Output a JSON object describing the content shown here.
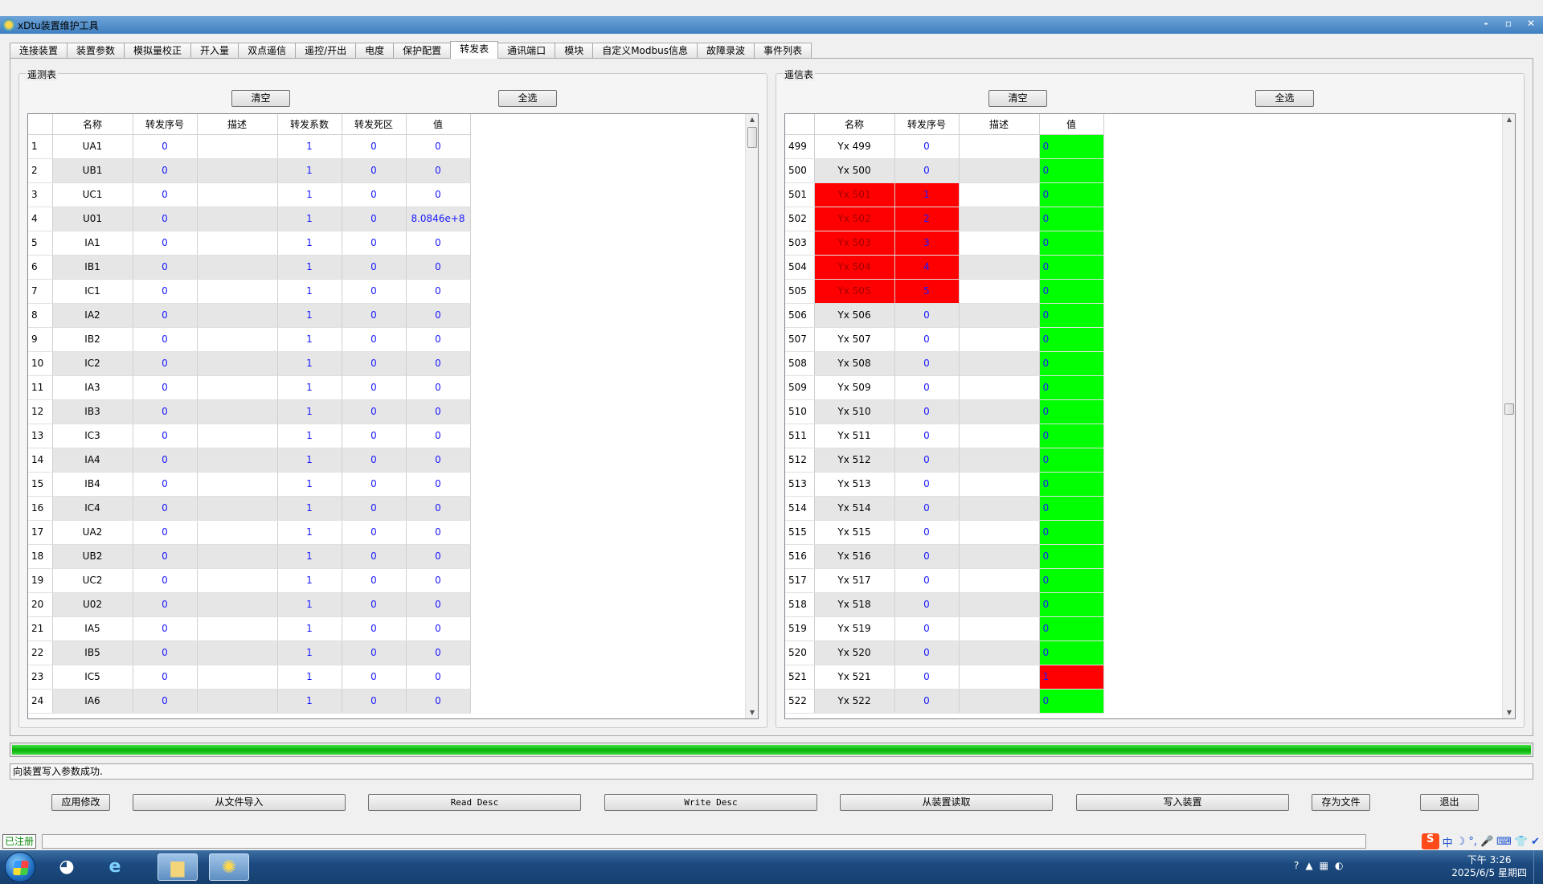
{
  "window": {
    "title": "xDtu装置维护工具",
    "controls": [
      "-",
      "▫",
      "✕"
    ]
  },
  "tabs": [
    "连接装置",
    "装置参数",
    "模拟量校正",
    "开入量",
    "双点遥信",
    "遥控/开出",
    "电度",
    "保护配置",
    "转发表",
    "通讯端口",
    "模块",
    "自定义Modbus信息",
    "故障录波",
    "事件列表"
  ],
  "active_tab_index": 8,
  "left_group": {
    "title": "遥测表",
    "clear_label": "清空",
    "select_all_label": "全选",
    "columns": [
      "名称",
      "转发序号",
      "描述",
      "转发系数",
      "转发死区",
      "值"
    ],
    "rows": [
      {
        "idx": "1",
        "name": "UA1",
        "seq": "0",
        "desc": "",
        "coef": "1",
        "dead": "0",
        "value": "0"
      },
      {
        "idx": "2",
        "name": "UB1",
        "seq": "0",
        "desc": "",
        "coef": "1",
        "dead": "0",
        "value": "0"
      },
      {
        "idx": "3",
        "name": "UC1",
        "seq": "0",
        "desc": "",
        "coef": "1",
        "dead": "0",
        "value": "0"
      },
      {
        "idx": "4",
        "name": "U01",
        "seq": "0",
        "desc": "",
        "coef": "1",
        "dead": "0",
        "value": "8.0846e+8"
      },
      {
        "idx": "5",
        "name": "IA1",
        "seq": "0",
        "desc": "",
        "coef": "1",
        "dead": "0",
        "value": "0"
      },
      {
        "idx": "6",
        "name": "IB1",
        "seq": "0",
        "desc": "",
        "coef": "1",
        "dead": "0",
        "value": "0"
      },
      {
        "idx": "7",
        "name": "IC1",
        "seq": "0",
        "desc": "",
        "coef": "1",
        "dead": "0",
        "value": "0"
      },
      {
        "idx": "8",
        "name": "IA2",
        "seq": "0",
        "desc": "",
        "coef": "1",
        "dead": "0",
        "value": "0"
      },
      {
        "idx": "9",
        "name": "IB2",
        "seq": "0",
        "desc": "",
        "coef": "1",
        "dead": "0",
        "value": "0"
      },
      {
        "idx": "10",
        "name": "IC2",
        "seq": "0",
        "desc": "",
        "coef": "1",
        "dead": "0",
        "value": "0"
      },
      {
        "idx": "11",
        "name": "IA3",
        "seq": "0",
        "desc": "",
        "coef": "1",
        "dead": "0",
        "value": "0"
      },
      {
        "idx": "12",
        "name": "IB3",
        "seq": "0",
        "desc": "",
        "coef": "1",
        "dead": "0",
        "value": "0"
      },
      {
        "idx": "13",
        "name": "IC3",
        "seq": "0",
        "desc": "",
        "coef": "1",
        "dead": "0",
        "value": "0"
      },
      {
        "idx": "14",
        "name": "IA4",
        "seq": "0",
        "desc": "",
        "coef": "1",
        "dead": "0",
        "value": "0"
      },
      {
        "idx": "15",
        "name": "IB4",
        "seq": "0",
        "desc": "",
        "coef": "1",
        "dead": "0",
        "value": "0"
      },
      {
        "idx": "16",
        "name": "IC4",
        "seq": "0",
        "desc": "",
        "coef": "1",
        "dead": "0",
        "value": "0"
      },
      {
        "idx": "17",
        "name": "UA2",
        "seq": "0",
        "desc": "",
        "coef": "1",
        "dead": "0",
        "value": "0"
      },
      {
        "idx": "18",
        "name": "UB2",
        "seq": "0",
        "desc": "",
        "coef": "1",
        "dead": "0",
        "value": "0"
      },
      {
        "idx": "19",
        "name": "UC2",
        "seq": "0",
        "desc": "",
        "coef": "1",
        "dead": "0",
        "value": "0"
      },
      {
        "idx": "20",
        "name": "U02",
        "seq": "0",
        "desc": "",
        "coef": "1",
        "dead": "0",
        "value": "0"
      },
      {
        "idx": "21",
        "name": "IA5",
        "seq": "0",
        "desc": "",
        "coef": "1",
        "dead": "0",
        "value": "0"
      },
      {
        "idx": "22",
        "name": "IB5",
        "seq": "0",
        "desc": "",
        "coef": "1",
        "dead": "0",
        "value": "0"
      },
      {
        "idx": "23",
        "name": "IC5",
        "seq": "0",
        "desc": "",
        "coef": "1",
        "dead": "0",
        "value": "0"
      },
      {
        "idx": "24",
        "name": "IA6",
        "seq": "0",
        "desc": "",
        "coef": "1",
        "dead": "0",
        "value": "0"
      }
    ]
  },
  "right_group": {
    "title": "遥信表",
    "clear_label": "清空",
    "select_all_label": "全选",
    "columns": [
      "名称",
      "转发序号",
      "描述",
      "值"
    ],
    "rows": [
      {
        "idx": "499",
        "name": "Yx 499",
        "seq": "0",
        "desc": "",
        "value": "0",
        "highlight": false,
        "value_on": false
      },
      {
        "idx": "500",
        "name": "Yx 500",
        "seq": "0",
        "desc": "",
        "value": "0",
        "highlight": false,
        "value_on": false
      },
      {
        "idx": "501",
        "name": "Yx 501",
        "seq": "1",
        "desc": "",
        "value": "0",
        "highlight": true,
        "value_on": false
      },
      {
        "idx": "502",
        "name": "Yx 502",
        "seq": "2",
        "desc": "",
        "value": "0",
        "highlight": true,
        "value_on": false
      },
      {
        "idx": "503",
        "name": "Yx 503",
        "seq": "3",
        "desc": "",
        "value": "0",
        "highlight": true,
        "value_on": false
      },
      {
        "idx": "504",
        "name": "Yx 504",
        "seq": "4",
        "desc": "",
        "value": "0",
        "highlight": true,
        "value_on": false
      },
      {
        "idx": "505",
        "name": "Yx 505",
        "seq": "5",
        "desc": "",
        "value": "0",
        "highlight": true,
        "value_on": false
      },
      {
        "idx": "506",
        "name": "Yx 506",
        "seq": "0",
        "desc": "",
        "value": "0",
        "highlight": false,
        "value_on": false
      },
      {
        "idx": "507",
        "name": "Yx 507",
        "seq": "0",
        "desc": "",
        "value": "0",
        "highlight": false,
        "value_on": false
      },
      {
        "idx": "508",
        "name": "Yx 508",
        "seq": "0",
        "desc": "",
        "value": "0",
        "highlight": false,
        "value_on": false
      },
      {
        "idx": "509",
        "name": "Yx 509",
        "seq": "0",
        "desc": "",
        "value": "0",
        "highlight": false,
        "value_on": false
      },
      {
        "idx": "510",
        "name": "Yx 510",
        "seq": "0",
        "desc": "",
        "value": "0",
        "highlight": false,
        "value_on": false
      },
      {
        "idx": "511",
        "name": "Yx 511",
        "seq": "0",
        "desc": "",
        "value": "0",
        "highlight": false,
        "value_on": false
      },
      {
        "idx": "512",
        "name": "Yx 512",
        "seq": "0",
        "desc": "",
        "value": "0",
        "highlight": false,
        "value_on": false
      },
      {
        "idx": "513",
        "name": "Yx 513",
        "seq": "0",
        "desc": "",
        "value": "0",
        "highlight": false,
        "value_on": false
      },
      {
        "idx": "514",
        "name": "Yx 514",
        "seq": "0",
        "desc": "",
        "value": "0",
        "highlight": false,
        "value_on": false
      },
      {
        "idx": "515",
        "name": "Yx 515",
        "seq": "0",
        "desc": "",
        "value": "0",
        "highlight": false,
        "value_on": false
      },
      {
        "idx": "516",
        "name": "Yx 516",
        "seq": "0",
        "desc": "",
        "value": "0",
        "highlight": false,
        "value_on": false
      },
      {
        "idx": "517",
        "name": "Yx 517",
        "seq": "0",
        "desc": "",
        "value": "0",
        "highlight": false,
        "value_on": false
      },
      {
        "idx": "518",
        "name": "Yx 518",
        "seq": "0",
        "desc": "",
        "value": "0",
        "highlight": false,
        "value_on": false
      },
      {
        "idx": "519",
        "name": "Yx 519",
        "seq": "0",
        "desc": "",
        "value": "0",
        "highlight": false,
        "value_on": false
      },
      {
        "idx": "520",
        "name": "Yx 520",
        "seq": "0",
        "desc": "",
        "value": "0",
        "highlight": false,
        "value_on": false
      },
      {
        "idx": "521",
        "name": "Yx 521",
        "seq": "0",
        "desc": "",
        "value": "1",
        "highlight": false,
        "value_on": true
      },
      {
        "idx": "522",
        "name": "Yx 522",
        "seq": "0",
        "desc": "",
        "value": "0",
        "highlight": false,
        "value_on": false
      }
    ]
  },
  "progress": 1.0,
  "status_message": "向装置写入参数成功.",
  "bottom_buttons": [
    "应用修改",
    "从文件导入",
    "Read Desc",
    "Write Desc",
    "从装置读取",
    "写入装置",
    "存为文件",
    "退出"
  ],
  "statusbar": {
    "registered_label": "已注册"
  },
  "ime_icons": [
    "S",
    "中",
    "☽",
    "°,",
    "🎤",
    "⌨",
    "👕",
    "✔"
  ],
  "taskbar": {
    "apps": [
      "windows-media-icon",
      "ie-icon",
      "explorer-icon",
      "xdtu-app-icon"
    ],
    "tray_icons": [
      "?",
      "▲"
    ],
    "clock_time": "下午 3:26",
    "clock_date": "2025/6/5 星期四"
  },
  "colors": {
    "highlight_red": "#ff0000",
    "value_green": "#00ff00",
    "number_blue": "#1a1aff",
    "progress_green": "#06b006"
  }
}
